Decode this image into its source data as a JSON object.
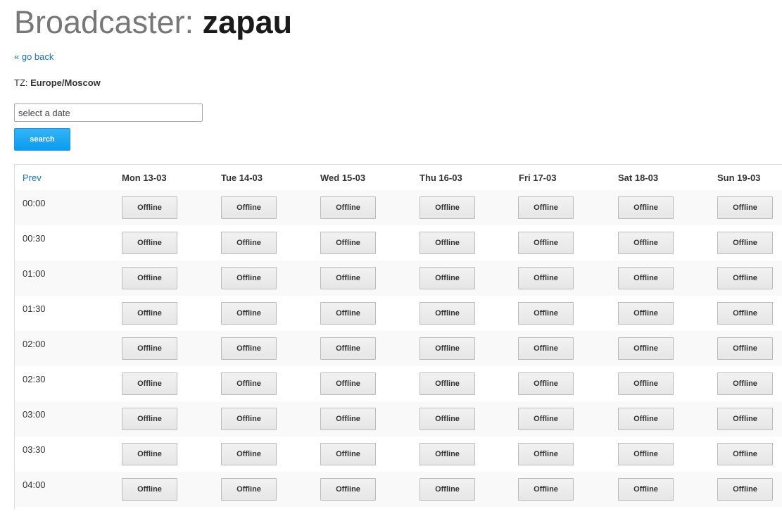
{
  "header": {
    "title_prefix": "Broadcaster: ",
    "broadcaster_name": "zapau"
  },
  "back_link": "« go back",
  "timezone": {
    "label": "TZ: ",
    "value": "Europe/Moscow"
  },
  "date_picker": {
    "placeholder": "select a date",
    "value": ""
  },
  "search_button": "search",
  "schedule": {
    "prev_label": "Prev",
    "days": [
      "Mon 13-03",
      "Tue 14-03",
      "Wed 15-03",
      "Thu 16-03",
      "Fri 17-03",
      "Sat 18-03",
      "Sun 19-03"
    ],
    "rows": [
      {
        "time": "00:00",
        "slots": [
          "Offline",
          "Offline",
          "Offline",
          "Offline",
          "Offline",
          "Offline",
          "Offline"
        ]
      },
      {
        "time": "00:30",
        "slots": [
          "Offline",
          "Offline",
          "Offline",
          "Offline",
          "Offline",
          "Offline",
          "Offline"
        ]
      },
      {
        "time": "01:00",
        "slots": [
          "Offline",
          "Offline",
          "Offline",
          "Offline",
          "Offline",
          "Offline",
          "Offline"
        ]
      },
      {
        "time": "01:30",
        "slots": [
          "Offline",
          "Offline",
          "Offline",
          "Offline",
          "Offline",
          "Offline",
          "Offline"
        ]
      },
      {
        "time": "02:00",
        "slots": [
          "Offline",
          "Offline",
          "Offline",
          "Offline",
          "Offline",
          "Offline",
          "Offline"
        ]
      },
      {
        "time": "02:30",
        "slots": [
          "Offline",
          "Offline",
          "Offline",
          "Offline",
          "Offline",
          "Offline",
          "Offline"
        ]
      },
      {
        "time": "03:00",
        "slots": [
          "Offline",
          "Offline",
          "Offline",
          "Offline",
          "Offline",
          "Offline",
          "Offline"
        ]
      },
      {
        "time": "03:30",
        "slots": [
          "Offline",
          "Offline",
          "Offline",
          "Offline",
          "Offline",
          "Offline",
          "Offline"
        ]
      },
      {
        "time": "04:00",
        "slots": [
          "Offline",
          "Offline",
          "Offline",
          "Offline",
          "Offline",
          "Offline",
          "Offline"
        ]
      }
    ]
  }
}
